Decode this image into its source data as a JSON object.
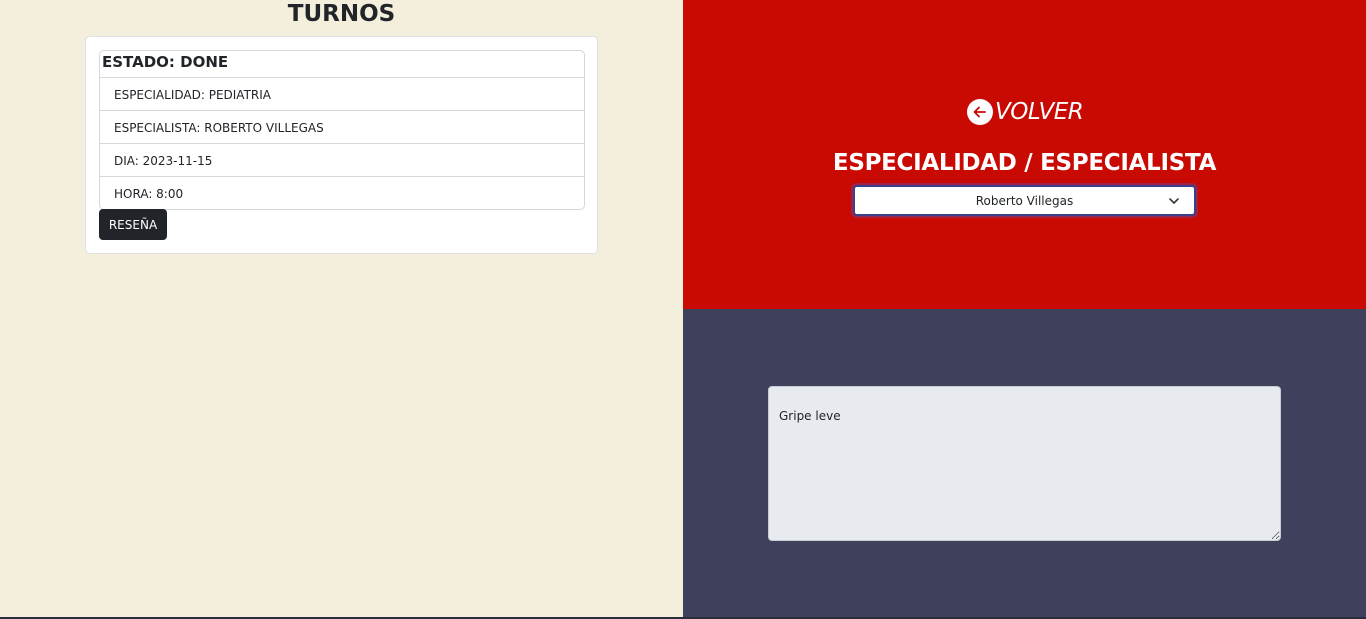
{
  "turnos": {
    "title": "TURNOS",
    "card": {
      "estado": "ESTADO: DONE",
      "especialidad": "ESPECIALIDAD: PEDIATRIA",
      "especialista": "ESPECIALISTA: ROBERTO VILLEGAS",
      "dia": "DIA: 2023-11-15",
      "hora": "HORA: 8:00",
      "resena_button": "RESEÑA"
    }
  },
  "review_panel": {
    "back": {
      "label": "VOLVER",
      "icon": "arrow-left-circle-icon"
    },
    "section_title": "ESPECIALIDAD / ESPECIALISTA",
    "select": {
      "value": "Roberto Villegas"
    },
    "review_text": "Gripe leve"
  },
  "colors": {
    "left_bg": "#f3efdc",
    "top_right_bg": "#c80a02",
    "bottom_right_bg": "#3e405c",
    "button_dark": "#212529"
  }
}
